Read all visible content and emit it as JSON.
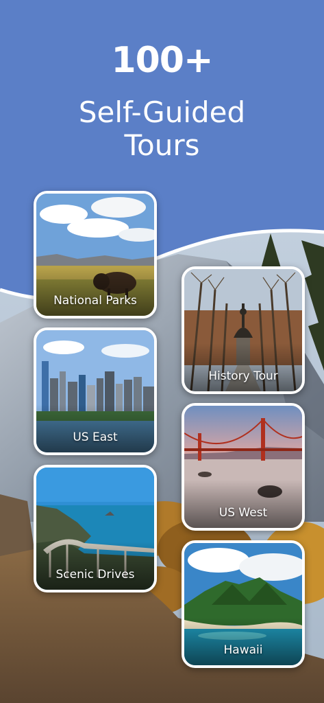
{
  "header": {
    "count": "100+",
    "subtitle_line1": "Self-Guided",
    "subtitle_line2": "Tours"
  },
  "colors": {
    "header_bg": "#5b7fc7",
    "card_border": "#ffffff",
    "text": "#ffffff"
  },
  "tours": [
    {
      "label": "National Parks",
      "image": "bison-prairie-image"
    },
    {
      "label": "History Tour",
      "image": "statue-avenue-image"
    },
    {
      "label": "US East",
      "image": "city-skyline-image"
    },
    {
      "label": "US West",
      "image": "golden-gate-bridge-image"
    },
    {
      "label": "Scenic Drives",
      "image": "coastal-bridge-image"
    },
    {
      "label": "Hawaii",
      "image": "island-coast-image"
    }
  ]
}
